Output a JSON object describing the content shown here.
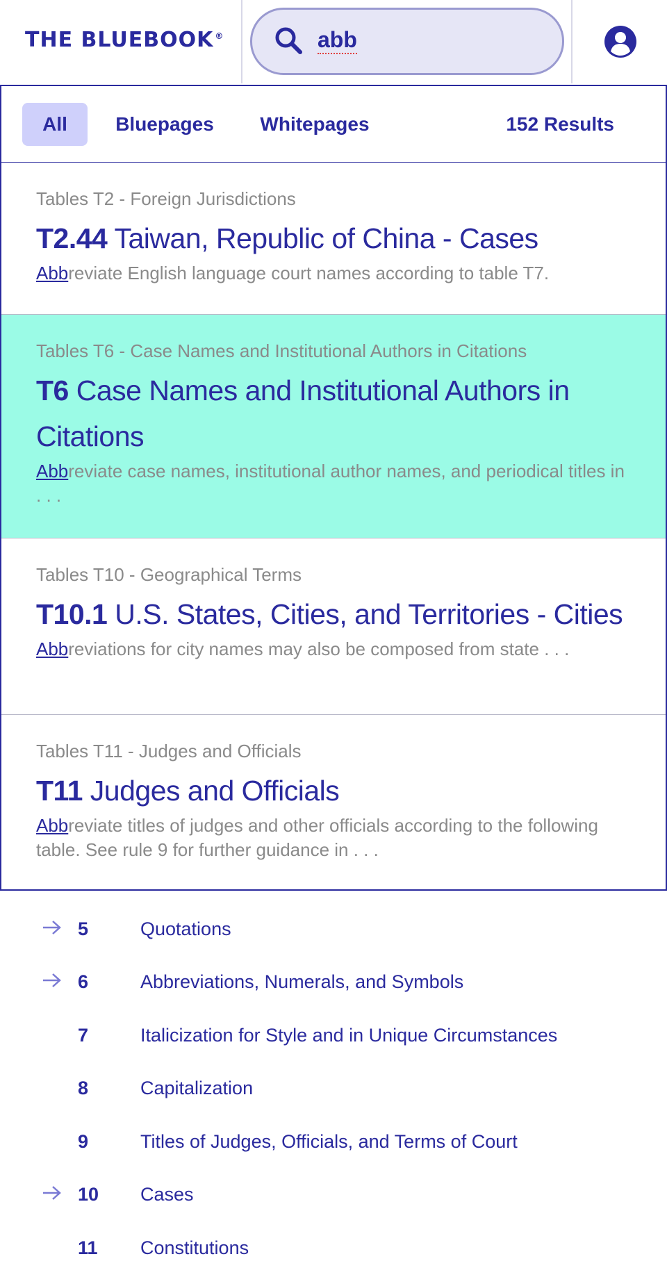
{
  "header": {
    "logo": "THE BLUEBOOK",
    "logo_mark": "®",
    "search": {
      "value": "abb"
    }
  },
  "tabs": {
    "all": "All",
    "bluepages": "Bluepages",
    "whitepages": "Whitepages",
    "results": "152 Results",
    "active": "All"
  },
  "results": [
    {
      "section": "Tables T2 - Foreign Jurisdictions",
      "num": "T2.44",
      "title": " Taiwan, Republic of China - Cases",
      "match": "Abb",
      "snippet": "reviate English language court names according to table T7."
    },
    {
      "section": "Tables T6 - Case Names and Institutional Authors in Citations",
      "num": "T6",
      "title": " Case Names and Institutional Authors in Citations",
      "match": "Abb",
      "snippet": "reviate case names, institutional author names, and periodical titles in . . ."
    },
    {
      "section": "Tables T10 - Geographical Terms",
      "num": "T10.1",
      "title": " U.S. States, Cities, and Territories - Cities",
      "match": "Abb",
      "snippet": "reviations for city names may also be composed from state . . ."
    },
    {
      "section": "Tables T11 - Judges and Officials",
      "num": "T11",
      "title": " Judges and Officials",
      "match": "Abb",
      "snippet": "reviate titles of judges and other officials according to the following table. See rule 9 for further guidance in . . ."
    }
  ],
  "toc": [
    {
      "num": "5",
      "label": "Quotations",
      "arrow": true
    },
    {
      "num": "6",
      "label": "Abbreviations, Numerals, and Symbols",
      "arrow": true
    },
    {
      "num": "7",
      "label": "Italicization for Style and in Unique Circumstances",
      "arrow": false
    },
    {
      "num": "8",
      "label": "Capitalization",
      "arrow": false
    },
    {
      "num": "9",
      "label": "Titles of Judges, Officials, and Terms of Court",
      "arrow": false
    },
    {
      "num": "10",
      "label": "Cases",
      "arrow": true
    },
    {
      "num": "11",
      "label": "Constitutions",
      "arrow": false
    }
  ],
  "colors": {
    "brand": "#2a2a9e",
    "highlight": "#9bfbe6",
    "tab_active": "#cfd0fb",
    "muted_text": "#8a8a8a"
  },
  "icons": {
    "search": "search-icon",
    "user": "user-icon",
    "arrow": "arrow-right-icon"
  }
}
